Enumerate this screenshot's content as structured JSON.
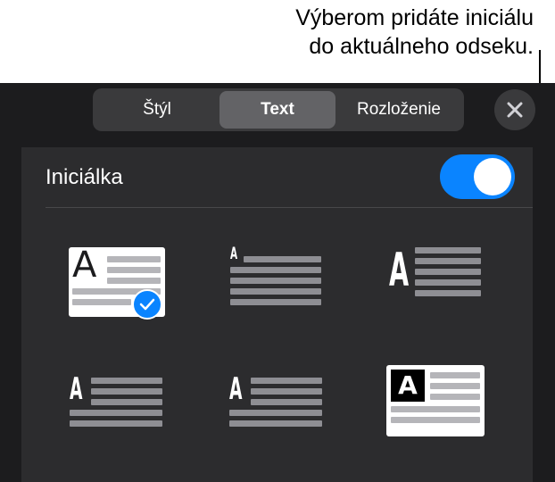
{
  "callout": {
    "line1": "Výberom pridáte iniciálu",
    "line2": "do aktuálneho odseku."
  },
  "tabs": [
    {
      "label": "Štýl",
      "active": false
    },
    {
      "label": "Text",
      "active": true
    },
    {
      "label": "Rozloženie",
      "active": false
    }
  ],
  "close_icon": "close-icon",
  "dropcap": {
    "label": "Iniciálka",
    "enabled": true,
    "accent": "#0a84ff"
  },
  "styles": [
    {
      "letter": "A",
      "selected": true
    },
    {
      "letter": "A",
      "selected": false
    },
    {
      "letter": "A",
      "selected": false
    },
    {
      "letter": "A",
      "selected": false
    },
    {
      "letter": "A",
      "selected": false
    },
    {
      "letter": "A",
      "selected": false
    }
  ]
}
